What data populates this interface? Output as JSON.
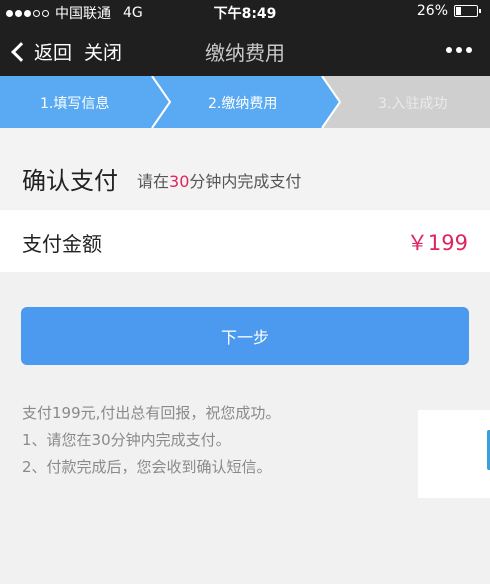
{
  "status_bar": {
    "carrier": "中国联通",
    "network": "4G",
    "time": "下午8:49",
    "battery": "26%"
  },
  "nav": {
    "back_label": "返回",
    "close_label": "关闭",
    "title": "缴纳费用"
  },
  "steps": [
    {
      "label": "1.填写信息",
      "state": "done"
    },
    {
      "label": "2.缴纳费用",
      "state": "active"
    },
    {
      "label": "3.入驻成功",
      "state": "pending"
    }
  ],
  "confirm": {
    "title": "确认支付",
    "sub_prefix": "请在",
    "sub_highlight": "30",
    "sub_suffix": "分钟内完成支付"
  },
  "payment": {
    "label": "支付金额",
    "amount": "￥199"
  },
  "next_button": "下一步",
  "notes": [
    "支付199元,付出总有回报，祝您成功。",
    "1、请您在30分钟内完成支付。",
    "2、付款完成后，您会收到确认短信。"
  ],
  "colors": {
    "step_blue": "#5aaaf3",
    "step_gray": "#cfcfcf",
    "accent_pink": "#e0245e",
    "button_blue": "#4b9af0"
  }
}
